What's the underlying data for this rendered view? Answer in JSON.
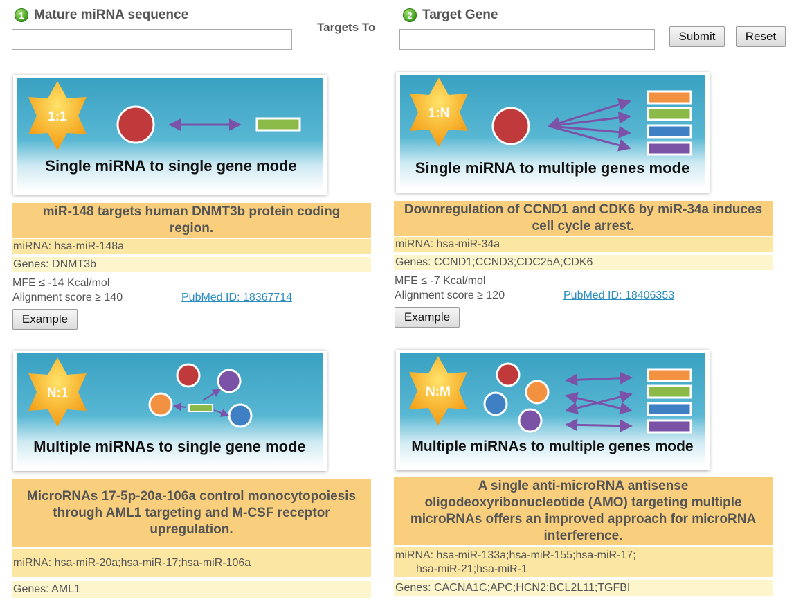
{
  "form": {
    "step1": {
      "number": "1",
      "label": "Mature miRNA sequence",
      "value": ""
    },
    "targets_to": "Targets To",
    "step2": {
      "number": "2",
      "label": "Target Gene",
      "value": ""
    },
    "submit_label": "Submit",
    "reset_label": "Reset"
  },
  "modes": [
    {
      "badge": "1:1",
      "caption": "Single miRNA to single gene mode",
      "example": {
        "title": "miR-148 targets human DNMT3b protein coding region.",
        "mirna": "miRNA: hsa-miR-148a",
        "genes": "Genes: DNMT3b",
        "mfe": "MFE ≤ -14 Kcal/mol",
        "alignment": "Alignment score ≥ 140",
        "pubmed": "PubMed ID: 18367714",
        "button": "Example"
      }
    },
    {
      "badge": "1:N",
      "caption": "Single miRNA to multiple genes mode",
      "example": {
        "title": "Downregulation of CCND1 and CDK6 by miR-34a induces cell cycle arrest.",
        "mirna": "miRNA: hsa-miR-34a",
        "genes": "Genes: CCND1;CCND3;CDC25A;CDK6",
        "mfe": "MFE ≤ -7 Kcal/mol",
        "alignment": "Alignment score ≥ 120",
        "pubmed": "PubMed ID: 18406353",
        "button": "Example"
      }
    },
    {
      "badge": "N:1",
      "caption": "Multiple miRNAs to single gene mode",
      "example": {
        "title": "MicroRNAs 17-5p-20a-106a control monocytopoiesis through AML1 targeting and M-CSF receptor upregulation.",
        "mirna": "miRNA: hsa-miR-20a;hsa-miR-17;hsa-miR-106a",
        "genes": "Genes: AML1"
      }
    },
    {
      "badge": "N:M",
      "caption": "Multiple miRNAs to multiple genes mode",
      "example": {
        "title": "A single anti-microRNA antisense oligodeoxyribonucleotide (AMO) targeting multiple microRNAs offers an improved approach for microRNA interference.",
        "mirna": "miRNA: hsa-miR-133a;hsa-miR-155;hsa-miR-17;",
        "mirna_cont": "hsa-miR-21;hsa-miR-1",
        "genes": "Genes: CACNA1C;APC;HCN2;BCL2L11;TGFBI"
      }
    }
  ],
  "colors": {
    "title_bg": "#f9cf7d",
    "mirna_row_bg": "#fbe6a2",
    "genes_row_bg": "#fdf6cd",
    "link": "#2b8dbf",
    "mirna_circle": "#c0393b",
    "banner_sky": "#3aa1c2",
    "star": "#f7a51c"
  },
  "icons": {
    "step_badge": "green-circle-number",
    "arrow": "double-headed-arrow"
  }
}
